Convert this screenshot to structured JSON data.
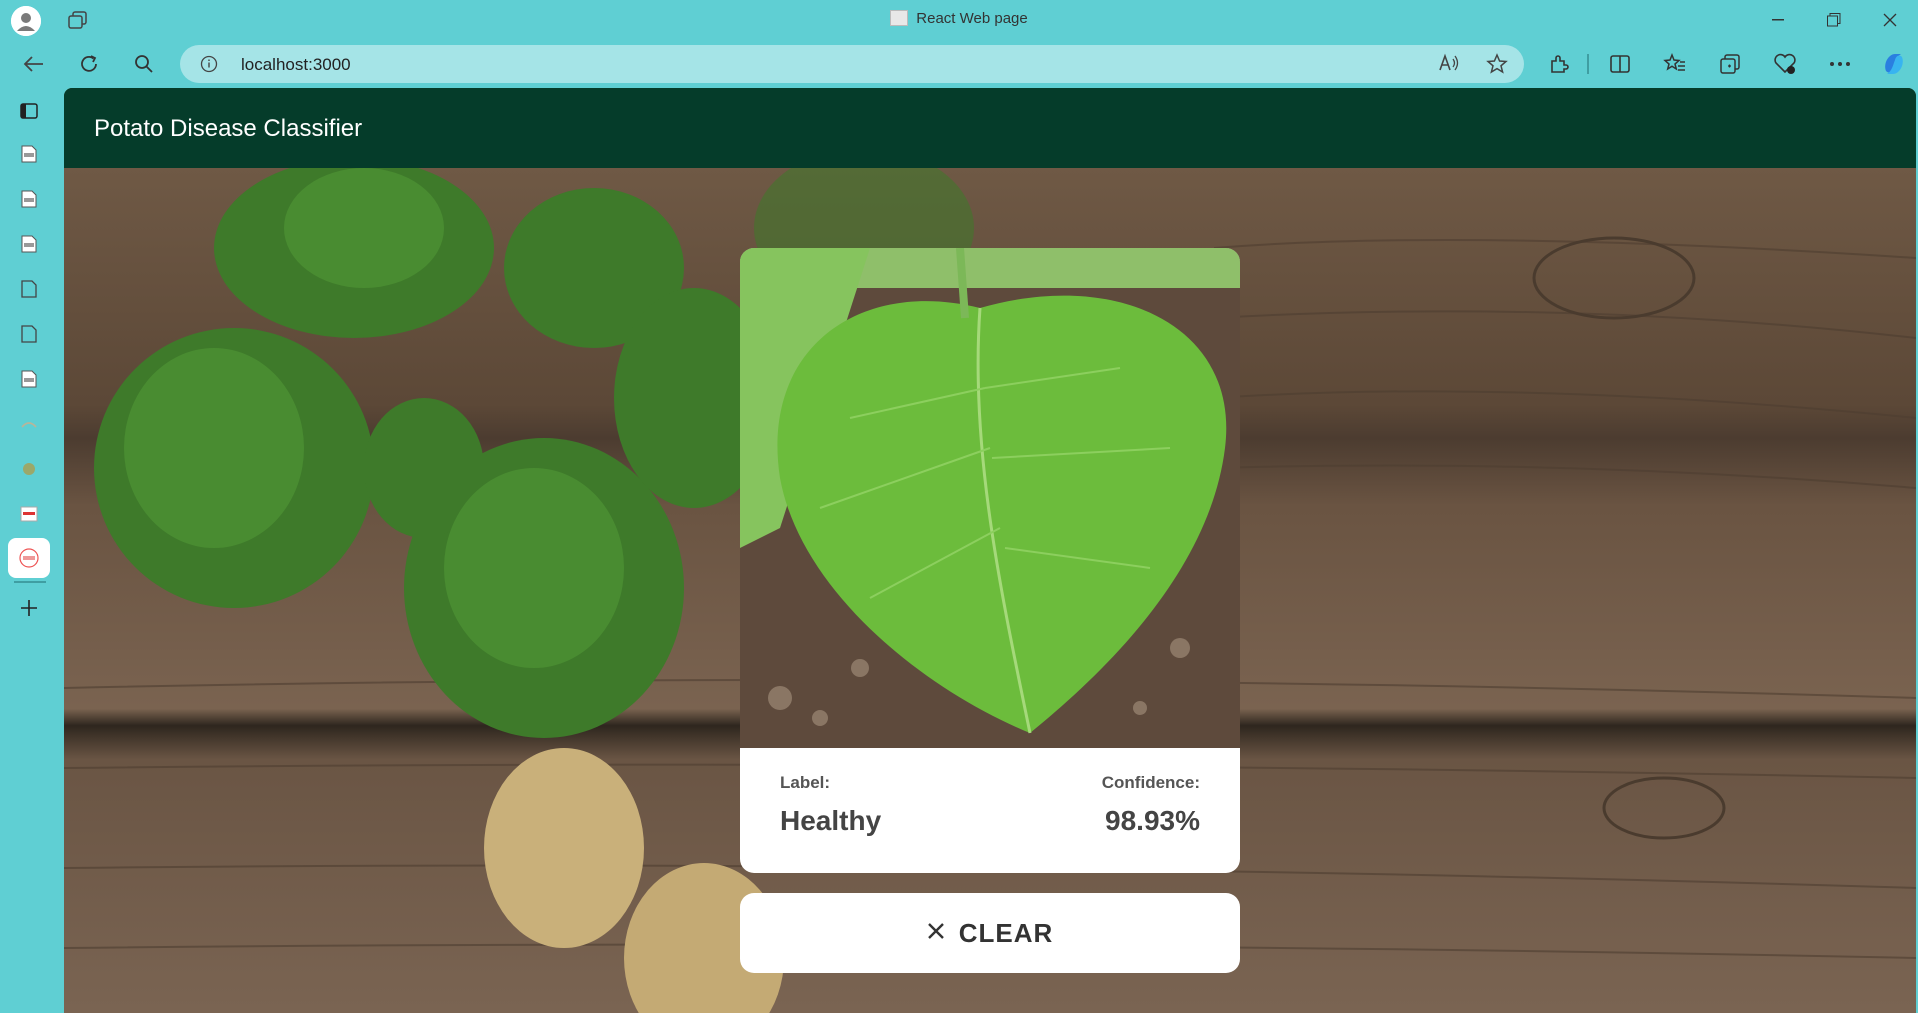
{
  "window": {
    "title": "React Web page"
  },
  "browser": {
    "url": "localhost:3000"
  },
  "app": {
    "title": "Potato Disease Classifier"
  },
  "result": {
    "label_heading": "Label:",
    "label_value": "Healthy",
    "confidence_heading": "Confidence:",
    "confidence_value": "98.93%"
  },
  "actions": {
    "clear_label": "CLEAR"
  },
  "colors": {
    "browser_chrome": "#5fcfd3",
    "app_bar": "#053c2a",
    "card": "#ffffff"
  }
}
